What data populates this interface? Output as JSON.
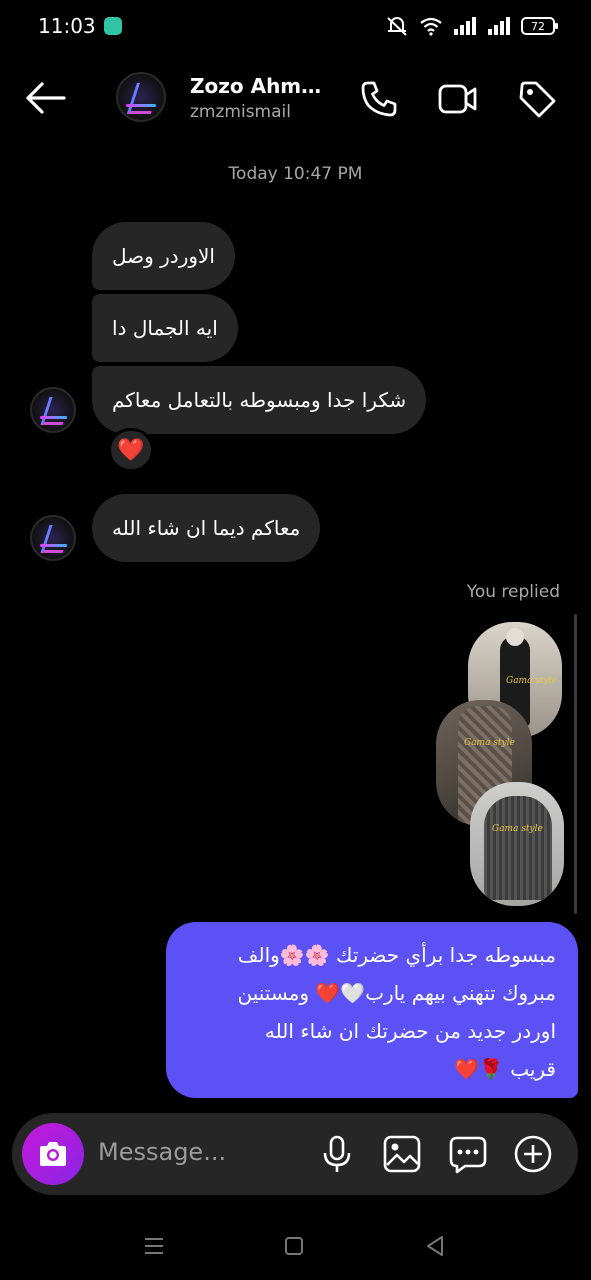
{
  "status_bar": {
    "time": "11:03",
    "battery": "72"
  },
  "header": {
    "name": "Zozo Ahm…",
    "username": "zmzmismail"
  },
  "conversation": {
    "date_label": "Today 10:47 PM",
    "received": [
      {
        "text": "الاوردر وصل"
      },
      {
        "text": "ايه الجمال دا"
      },
      {
        "text": "شكرا  جدا ومبسوطه بالتعامل معاكم"
      },
      {
        "text": "معاكم ديما ان شاء الله"
      }
    ],
    "reaction": "❤️",
    "you_replied": "You replied",
    "reply_photo_watermark": "Gama style",
    "sent_lines": [
      "مبسوطه جدا برأي حضرتك 🌸🌸والف",
      "مبروك  تتهني بيهم يارب🤍❤️ ومستنين",
      "اوردر جديد من حضرتك ان شاء الله",
      "قريب 🌹❤️"
    ]
  },
  "composer": {
    "placeholder": "Message..."
  },
  "colors": {
    "background": "#000000",
    "received_bubble": "#262626",
    "sent_bubble": "#5b51f5",
    "camera_button": "#c41ad8",
    "secondary_text": "#a8a8a8"
  },
  "icons": {
    "back": "arrow-left-icon",
    "call": "phone-icon",
    "video": "video-camera-icon",
    "tag": "tag-icon",
    "camera": "camera-icon",
    "mic": "microphone-icon",
    "gallery": "image-icon",
    "sticker": "chat-bubble-dots-icon",
    "plus": "plus-circle-icon"
  }
}
